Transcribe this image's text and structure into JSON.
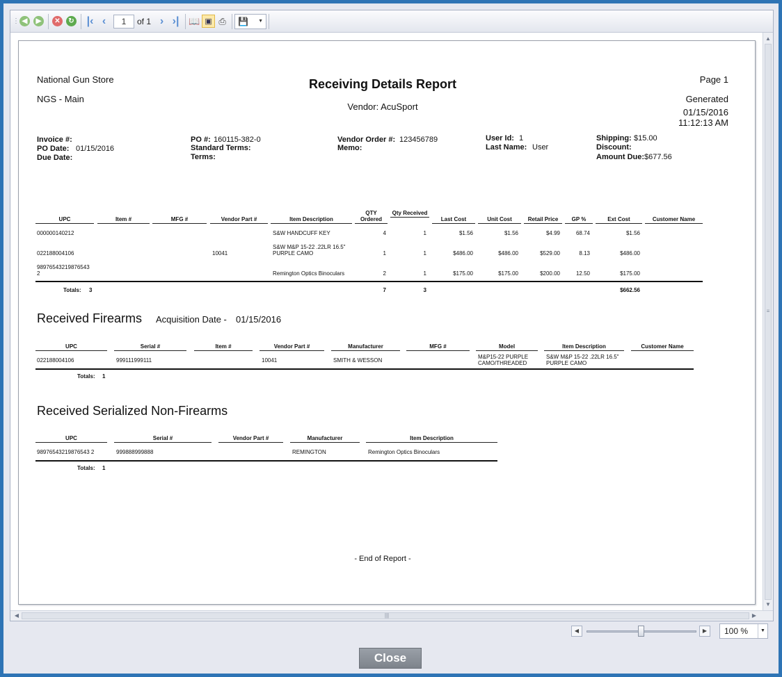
{
  "toolbar": {
    "page_number": "1",
    "page_of": "of 1"
  },
  "zoom": {
    "value": "100 %"
  },
  "close_label": "Close",
  "report": {
    "store": "National Gun Store",
    "location": "NGS - Main",
    "title": "Receiving Details Report",
    "vendor_line": "Vendor: AcuSport",
    "page_label": "Page 1",
    "generated_label": "Generated",
    "generated_date": "01/15/2016",
    "generated_time": "11:12:13 AM",
    "info": {
      "invoice_label": "Invoice #:",
      "po_date_label": "PO Date:",
      "po_date": "01/15/2016",
      "due_date_label": "Due Date:",
      "po_label": "PO #:",
      "po": "160115-382-0",
      "standard_terms_label": "Standard Terms:",
      "terms_label": "Terms:",
      "vendor_order_label": "Vendor Order #:",
      "vendor_order": "123456789",
      "memo_label": "Memo:",
      "user_id_label": "User Id:",
      "user_id": "1",
      "last_name_label": "Last Name:",
      "last_name": "User",
      "shipping_label": "Shipping:",
      "shipping": "$15.00",
      "discount_label": "Discount:",
      "amount_due_label": "Amount Due:",
      "amount_due": "$677.56"
    },
    "items": {
      "headers": [
        "UPC",
        "Item #",
        "MFG #",
        "Vendor Part #",
        "Item Description",
        "QTY Ordered",
        "Qty Received",
        "Last Cost",
        "Unit Cost",
        "Retail Price",
        "GP %",
        "Ext Cost",
        "Customer Name"
      ],
      "rows": [
        {
          "upc": "000000140212",
          "item": "",
          "mfg": "",
          "vendor_part": "",
          "desc": "S&W HANDCUFF KEY",
          "qty_ordered": "4",
          "qty_received": "1",
          "last_cost": "$1.56",
          "unit_cost": "$1.56",
          "retail": "$4.99",
          "gp": "68.74",
          "ext_cost": "$1.56",
          "customer": ""
        },
        {
          "upc": "022188004106",
          "item": "",
          "mfg": "",
          "vendor_part": "10041",
          "desc": "S&W M&P 15-22 .22LR 16.5\" PURPLE CAMO",
          "qty_ordered": "1",
          "qty_received": "1",
          "last_cost": "$486.00",
          "unit_cost": "$486.00",
          "retail": "$529.00",
          "gp": "8.13",
          "ext_cost": "$486.00",
          "customer": ""
        },
        {
          "upc": "98976543219876543 2",
          "item": "",
          "mfg": "",
          "vendor_part": "",
          "desc": "Remington Optics Binoculars",
          "qty_ordered": "2",
          "qty_received": "1",
          "last_cost": "$175.00",
          "unit_cost": "$175.00",
          "retail": "$200.00",
          "gp": "12.50",
          "ext_cost": "$175.00",
          "customer": ""
        }
      ],
      "totals_label": "Totals:",
      "totals_count": "3",
      "total_ordered": "7",
      "total_received": "3",
      "total_ext_cost": "$662.56"
    },
    "firearms": {
      "title": "Received Firearms",
      "acq_label": "Acquisition Date -",
      "acq_date": "01/15/2016",
      "headers": [
        "UPC",
        "Serial #",
        "Item #",
        "Vendor Part #",
        "Manufacturer",
        "MFG #",
        "Model",
        "Item Description",
        "Customer Name"
      ],
      "rows": [
        {
          "upc": "022188004106",
          "serial": "999111999111",
          "item": "",
          "vendor_part": "10041",
          "manufacturer": "SMITH & WESSON",
          "mfg": "",
          "model": "M&P15-22 PURPLE CAMO/THREADED",
          "desc": "S&W M&P 15-22 .22LR 16.5\" PURPLE CAMO",
          "customer": ""
        }
      ],
      "totals_label": "Totals:",
      "totals_count": "1"
    },
    "nonfirearms": {
      "title": "Received Serialized Non-Firearms",
      "headers": [
        "UPC",
        "Serial #",
        "Vendor Part #",
        "Manufacturer",
        "Item Description"
      ],
      "rows": [
        {
          "upc": "98976543219876543 2",
          "serial": "999888999888",
          "vendor_part": "",
          "manufacturer": "REMINGTON",
          "desc": "Remington Optics Binoculars"
        }
      ],
      "totals_label": "Totals:",
      "totals_count": "1"
    },
    "end_text": "- End of Report -"
  }
}
